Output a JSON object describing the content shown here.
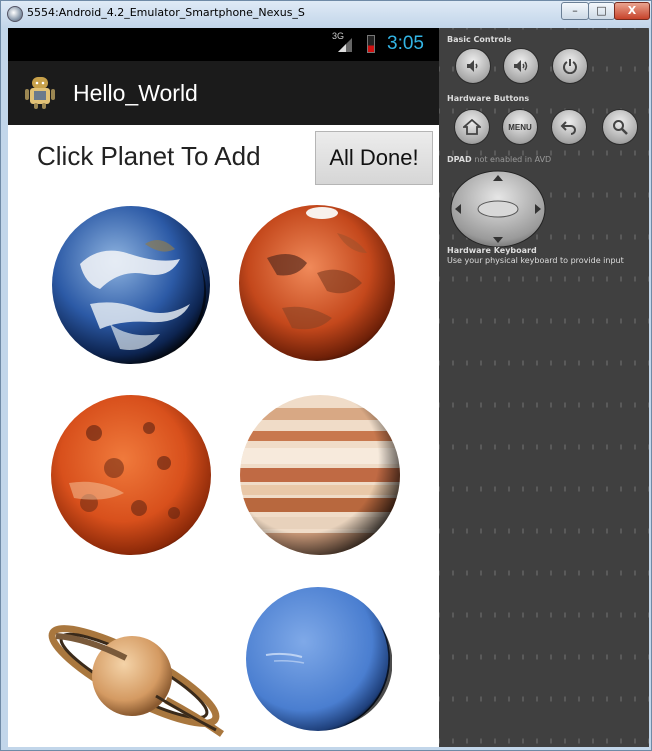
{
  "window": {
    "title": "5554:Android_4.2_Emulator_Smartphone_Nexus_S",
    "buttons": {
      "minimize": "–",
      "maximize": "□",
      "close": "X"
    }
  },
  "status_bar": {
    "network": "3G",
    "time": "3:05",
    "battery_color": "#d01010"
  },
  "action_bar": {
    "title": "Hello_World",
    "icon": "android-app-icon"
  },
  "main": {
    "prompt": "Click Planet To Add",
    "done_button": "All Done!",
    "planets": [
      {
        "name": "earth",
        "icon": "earth-icon"
      },
      {
        "name": "mars",
        "icon": "mars-icon"
      },
      {
        "name": "red-planet",
        "icon": "red-planet-icon"
      },
      {
        "name": "jupiter",
        "icon": "jupiter-icon"
      },
      {
        "name": "saturn",
        "icon": "saturn-icon"
      },
      {
        "name": "neptune",
        "icon": "neptune-icon"
      }
    ]
  },
  "controls_panel": {
    "basic_controls_title": "Basic Controls",
    "basic_controls": [
      "volume-down-icon",
      "volume-up-icon",
      "power-icon"
    ],
    "hardware_buttons_title": "Hardware Buttons",
    "hardware_buttons": {
      "home": "home-icon",
      "menu": "MENU",
      "back": "back-icon",
      "search": "search-icon"
    },
    "dpad_title_prefix": "DPAD",
    "dpad_title_suffix": "not enabled in AVD",
    "keyboard_title": "Hardware Keyboard",
    "keyboard_note": "Use your physical keyboard to provide input"
  },
  "colors": {
    "accent_time": "#33b5e5",
    "action_bar": "#1b1b1b",
    "panel": "#404040"
  }
}
